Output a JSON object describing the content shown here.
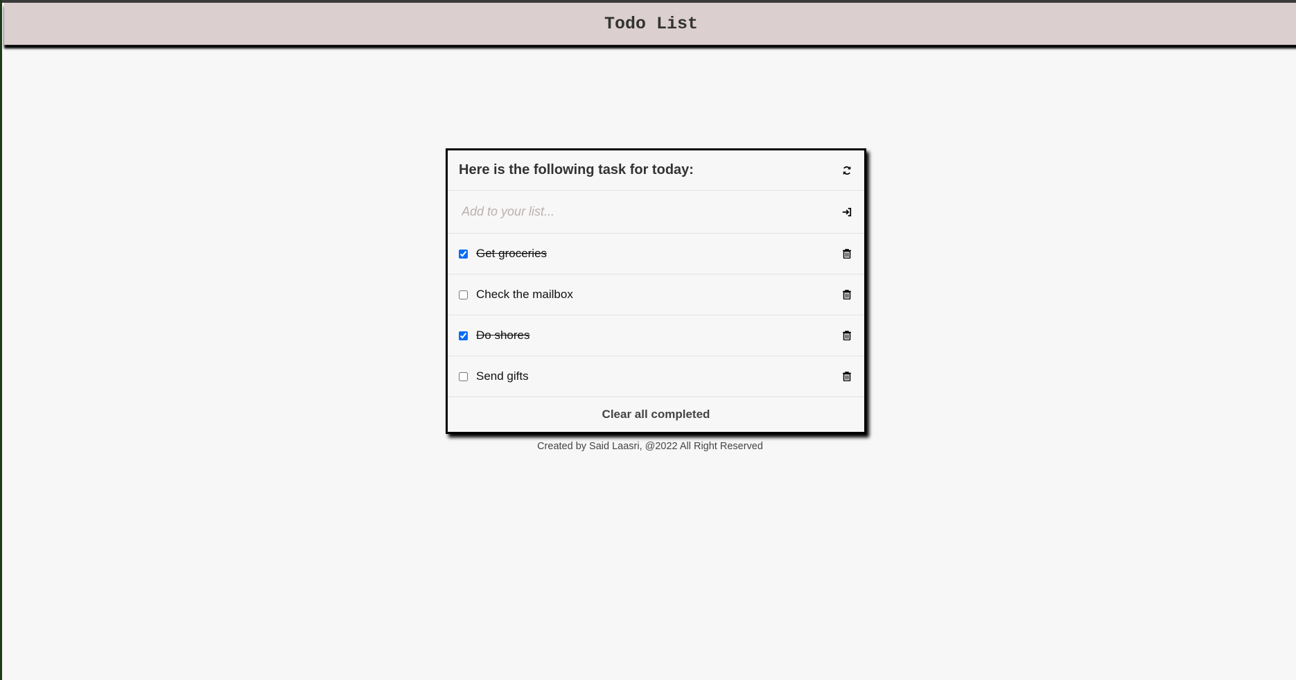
{
  "header": {
    "title": "Todo List"
  },
  "card": {
    "title": "Here is the following task for today:",
    "input": {
      "placeholder": "Add to your list...",
      "value": ""
    },
    "items": [
      {
        "label": "Get groceries",
        "completed": true
      },
      {
        "label": "Check the mailbox",
        "completed": false
      },
      {
        "label": "Do shores",
        "completed": true
      },
      {
        "label": "Send gifts",
        "completed": false
      }
    ],
    "clear_label": "Clear all completed"
  },
  "footer": {
    "text": "Created by Said Laasri, @2022 All Right Reserved"
  },
  "colors": {
    "header_bg": "#dbd0cf",
    "checkbox": "#0a6cf5"
  }
}
